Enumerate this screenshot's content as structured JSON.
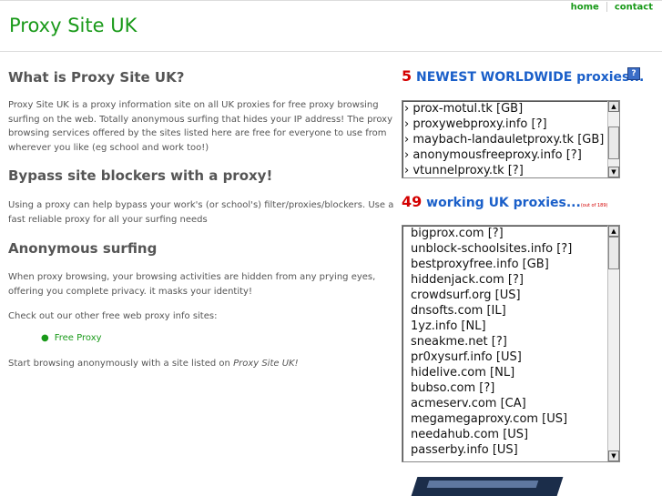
{
  "header": {
    "site_title": "Proxy Site UK",
    "nav": [
      {
        "label": "home"
      },
      {
        "label": "contact"
      }
    ]
  },
  "main": {
    "what": {
      "heading": "What is Proxy Site UK?",
      "text": "Proxy Site UK is a proxy information site on all UK proxies for free proxy browsing surfing on the web. Totally anonymous surfing that hides your IP address! The proxy browsing services offered by the sites listed here are free for everyone to use from wherever you like (eg school and work too!)"
    },
    "bypass": {
      "heading": "Bypass site blockers with a proxy!",
      "text": "Using a proxy can help bypass your work's (or school's) filter/proxies/blockers. Use a fast reliable proxy for all your surfing needs"
    },
    "anon": {
      "heading": "Anonymous surfing",
      "text": "When proxy browsing, your browsing activities are hidden from any prying eyes, offering you complete privacy. it masks your identity!"
    },
    "check_text": "Check out our other free web proxy info sites:",
    "links": [
      {
        "label": "Free Proxy"
      }
    ],
    "start_text_prefix": "Start browsing anonymously with a site listed on ",
    "start_text_em": "Proxy Site UK!"
  },
  "newest": {
    "count": "5",
    "heading": " NEWEST WORLDWIDE proxies...",
    "help_icon_glyph": "?",
    "items": [
      "› prox-motul.tk   [GB]",
      "› proxywebproxy.info   [?]",
      "› maybach-landauletproxy.tk   [GB]",
      "› anonymousfreeproxy.info   [?]",
      "› vtunnelproxy.tk   [?]"
    ]
  },
  "working": {
    "count": "49",
    "heading": " working UK proxies...",
    "note": "(out of 189)",
    "items": [
      "bigprox.com   [?]",
      "unblock-schoolsites.info   [?]",
      "bestproxyfree.info   [GB]",
      "hiddenjack.com   [?]",
      "crowdsurf.org   [US]",
      "dnsofts.com   [IL]",
      "1yz.info   [NL]",
      "sneakme.net   [?]",
      "pr0xysurf.info   [US]",
      "hidelive.com   [NL]",
      "bubso.com   [?]",
      "acmeserv.com   [CA]",
      "megamegaproxy.com   [US]",
      "needahub.com   [US]",
      "passerby.info   [US]"
    ]
  },
  "colors": {
    "brand_green": "#1a9a1a",
    "count_red": "#d40000",
    "heading_blue": "#1a5fc9"
  }
}
